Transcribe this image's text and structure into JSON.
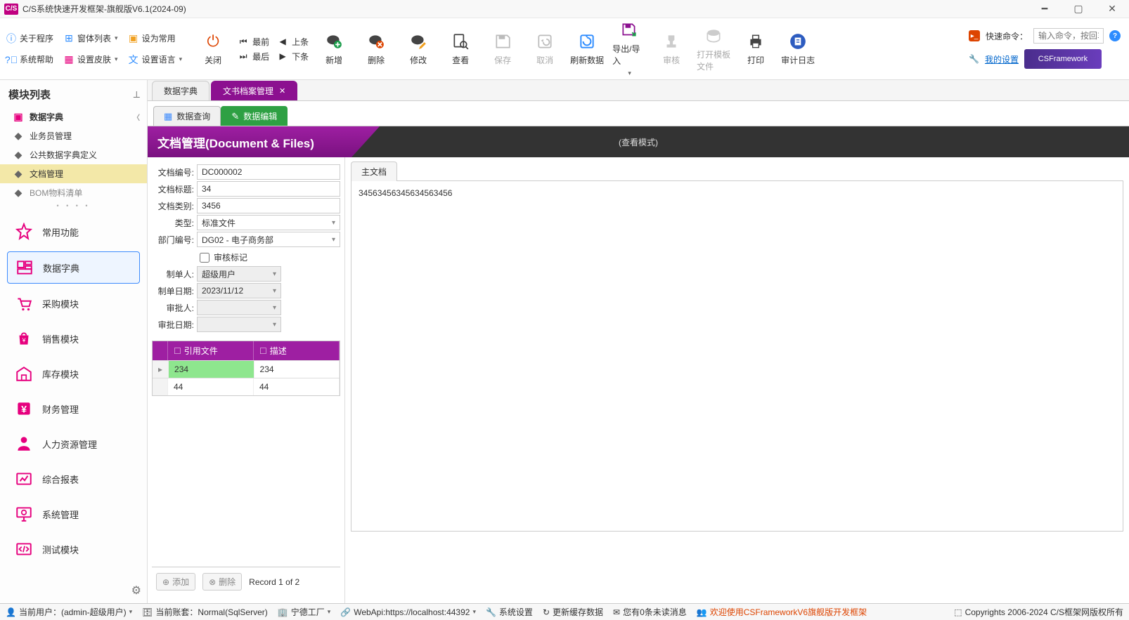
{
  "window": {
    "title": "C/S系统快速开发框架-旗舰版V6.1(2024-09)"
  },
  "ribbon": {
    "row1": {
      "about": "关于程序",
      "window_list": "窗体列表",
      "set_common": "设为常用"
    },
    "row2": {
      "help": "系统帮助",
      "skin": "设置皮肤",
      "language": "设置语言"
    },
    "close": "关闭",
    "first": "最前",
    "prev": "上条",
    "last": "最后",
    "next": "下条",
    "add": "新增",
    "delete": "删除",
    "edit": "修改",
    "view": "查看",
    "save": "保存",
    "cancel": "取消",
    "refresh": "刷新数据",
    "export": "导出/导入",
    "approve": "审核",
    "open_tpl": "打开模板文件",
    "print": "打印",
    "audit_log": "审计日志",
    "quick_cmd_label": "快速命令：",
    "quick_cmd_ph": "输入命令，按回车",
    "my_settings": "我的设置",
    "brand": "CSFramework"
  },
  "sidebar": {
    "title": "模块列表",
    "tree": {
      "root": "数据字典",
      "items": [
        "业务员管理",
        "公共数据字典定义",
        "文档管理",
        "BOM物料清单"
      ]
    },
    "nav": [
      {
        "label": "常用功能",
        "color": "#e6007e"
      },
      {
        "label": "数据字典",
        "color": "#e6007e"
      },
      {
        "label": "采购模块",
        "color": "#e6007e"
      },
      {
        "label": "销售模块",
        "color": "#e6007e"
      },
      {
        "label": "库存模块",
        "color": "#e6007e"
      },
      {
        "label": "财务管理",
        "color": "#e6007e"
      },
      {
        "label": "人力资源管理",
        "color": "#e6007e"
      },
      {
        "label": "综合报表",
        "color": "#e6007e"
      },
      {
        "label": "系统管理",
        "color": "#e6007e"
      },
      {
        "label": "测试模块",
        "color": "#e6007e"
      }
    ]
  },
  "tabs": {
    "doc1": "数据字典",
    "doc2": "文书档案管理",
    "sub1": "数据查询",
    "sub2": "数据编辑"
  },
  "banner": {
    "title": "文档管理(Document & Files)",
    "mode": "(查看模式)"
  },
  "form": {
    "doc_no_label": "文档编号:",
    "doc_no": "DC000002",
    "title_label": "文档标题:",
    "title": "34",
    "category_label": "文档类别:",
    "category": "3456",
    "type_label": "类型:",
    "type": "标准文件",
    "dept_label": "部门编号:",
    "dept": "DG02 - 电子商务部",
    "approve_chk": "审核标记",
    "creator_label": "制单人:",
    "creator": "超级用户",
    "create_date_label": "制单日期:",
    "create_date": "2023/11/12",
    "approver_label": "审批人:",
    "approver": "",
    "approve_date_label": "审批日期:",
    "approve_date": ""
  },
  "grid": {
    "col1": "引用文件",
    "col2": "描述",
    "rows": [
      {
        "ref": "234",
        "desc": "234"
      },
      {
        "ref": "44",
        "desc": "44"
      }
    ],
    "add_btn": "添加",
    "del_btn": "删除",
    "record": "Record 1 of 2"
  },
  "right_panel": {
    "tab": "主文档",
    "content": "34563456345634563456"
  },
  "status": {
    "user": "当前用户：(admin-超级用户)",
    "account": "当前账套：Normal(SqlServer)",
    "factory": "宁德工厂",
    "webapi": "WebApi:https://localhost:44392",
    "sys_settings": "系统设置",
    "refresh_cache": "更新缓存数据",
    "unread": "您有0条未读消息",
    "welcome": "欢迎使用CSFrameworkV6旗舰版开发框架",
    "copyright": "Copyrights 2006-2024 C/S框架网版权所有"
  }
}
